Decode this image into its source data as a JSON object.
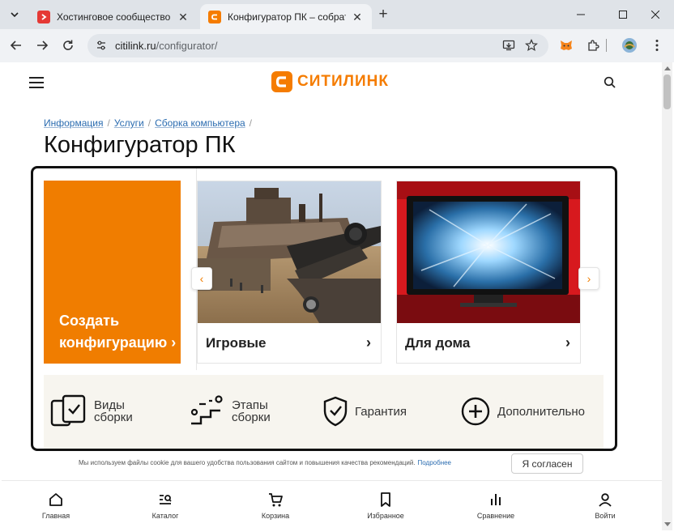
{
  "browser": {
    "tabs": [
      {
        "title": "Хостинговое сообщество «Tim",
        "active": false,
        "favicon": "timeweb-favicon",
        "favicon_color": "#e53935"
      },
      {
        "title": "Конфигуратор ПК – собрать ко",
        "active": true,
        "favicon": "citilink-favicon",
        "favicon_color": "#f57c00"
      }
    ],
    "new_tab_label": "+",
    "close_glyph": "✕",
    "address": {
      "host": "citilink.ru",
      "path": "/configurator/"
    }
  },
  "site": {
    "brand": "СИТИЛИНК",
    "brand_color": "#f57c00",
    "breadcrumbs": [
      "Информация",
      "Услуги",
      "Сборка компьютера"
    ],
    "breadcrumb_separator": "/",
    "title": "Конфигуратор ПК",
    "create_card": {
      "label": "Создать конфигурацию ›",
      "color": "#f07d00"
    },
    "categories": [
      {
        "name": "Игровые",
        "arrow": "›",
        "image": "gaming-scene-image"
      },
      {
        "name": "Для дома",
        "arrow": "›",
        "image": "home-monitor-image"
      }
    ],
    "carousel": {
      "prev": "‹",
      "next": "›"
    },
    "features": [
      {
        "label": "Виды сборки",
        "icon": "build-types-icon"
      },
      {
        "label": "Этапы сборки",
        "icon": "build-stages-icon"
      },
      {
        "label": "Гарантия",
        "icon": "shield-check-icon"
      },
      {
        "label": "Дополнительно",
        "icon": "plus-circle-icon"
      }
    ],
    "cookie": {
      "text": "Мы используем файлы cookie для вашего удобства пользования сайтом и повышения качества рекомендаций.",
      "link": "Подробнее",
      "button": "Я согласен"
    },
    "bottom_nav": [
      {
        "label": "Главная",
        "icon": "home-icon"
      },
      {
        "label": "Каталог",
        "icon": "catalog-icon"
      },
      {
        "label": "Корзина",
        "icon": "cart-icon"
      },
      {
        "label": "Избранное",
        "icon": "bookmark-icon"
      },
      {
        "label": "Сравнение",
        "icon": "compare-icon"
      },
      {
        "label": "Войти",
        "icon": "user-icon"
      }
    ]
  }
}
